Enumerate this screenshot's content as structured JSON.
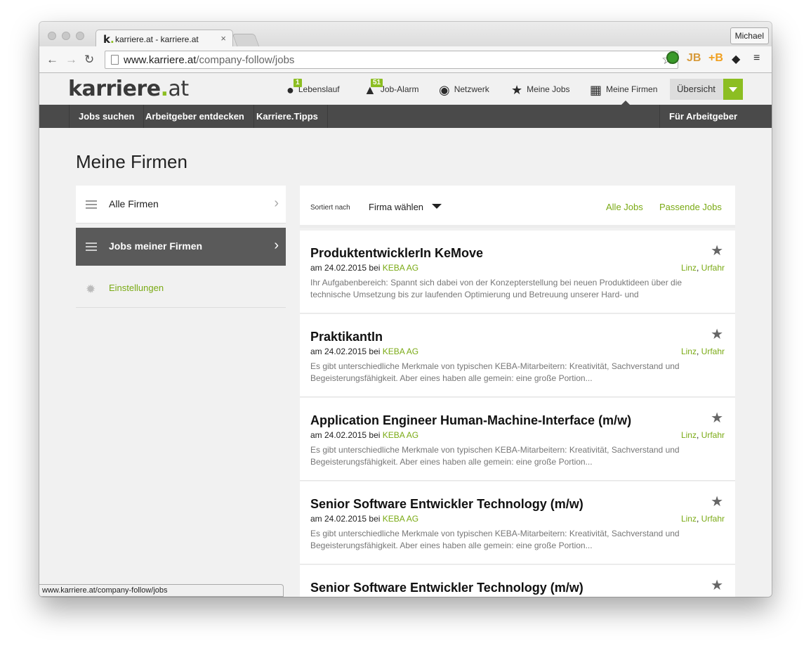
{
  "browser": {
    "tab_title": "karriere.at - karriere.at",
    "tab_close": "×",
    "profile": "Michael",
    "url_host": "www.karriere.at",
    "url_path": "/company-follow/jobs",
    "status_url": "www.karriere.at/company-follow/jobs",
    "extensions": [
      "JB",
      "+B"
    ]
  },
  "site": {
    "logo_main": "karriere",
    "logo_dot": ".",
    "logo_tld": "at",
    "header_nav": [
      {
        "label": "Lebenslauf",
        "icon": "user-icon",
        "badge": "1"
      },
      {
        "label": "Job-Alarm",
        "icon": "bell-icon",
        "badge": "51"
      },
      {
        "label": "Netzwerk",
        "icon": "globe-icon"
      },
      {
        "label": "Meine Jobs",
        "icon": "star-icon"
      },
      {
        "label": "Meine Firmen",
        "icon": "building-icon"
      }
    ],
    "overview_button": "Übersicht",
    "main_nav": [
      "Jobs suchen",
      "Arbeitgeber entdecken",
      "Karriere.Tipps"
    ],
    "employer_nav": "Für Arbeitgeber"
  },
  "page": {
    "title": "Meine Firmen",
    "sidebar": [
      {
        "label": "Alle Firmen"
      },
      {
        "label": "Jobs meiner Firmen",
        "active": true
      },
      {
        "label": "Einstellungen"
      }
    ],
    "sort_label": "Sortiert nach",
    "sort_select": "Firma wählen",
    "filter_all": "Alle Jobs",
    "filter_matching": "Passende Jobs",
    "jobs": [
      {
        "title": "ProduktentwicklerIn KeMove",
        "date_prefix": "am 24.02.2015 bei",
        "company": "KEBA AG",
        "loc1": "Linz",
        "loc2": "Urfahr",
        "desc": "Ihr Aufgabenbereich: Spannt sich dabei von der Konzepterstellung bei neuen Produktideen über die technische Umsetzung bis zur laufenden Optimierung und Betreuung unserer Hard- und"
      },
      {
        "title": "PraktikantIn",
        "date_prefix": "am 24.02.2015 bei",
        "company": "KEBA AG",
        "loc1": "Linz",
        "loc2": "Urfahr",
        "desc": "Es gibt unterschiedliche Merkmale von typischen KEBA-Mitarbeitern: Kreativität, Sachverstand und Begeisterungsfähigkeit. Aber eines haben alle gemein: eine große Portion..."
      },
      {
        "title": "Application Engineer Human-Machine-Interface (m/w)",
        "date_prefix": "am 24.02.2015 bei",
        "company": "KEBA AG",
        "loc1": "Linz",
        "loc2": "Urfahr",
        "desc": "Es gibt unterschiedliche Merkmale von typischen KEBA-Mitarbeitern: Kreativität, Sachverstand und Begeisterungsfähigkeit. Aber eines haben alle gemein: eine große Portion..."
      },
      {
        "title": "Senior Software Entwickler Technology (m/w)",
        "date_prefix": "am 24.02.2015 bei",
        "company": "KEBA AG",
        "loc1": "Linz",
        "loc2": "Urfahr",
        "desc": "Es gibt unterschiedliche Merkmale von typischen KEBA-Mitarbeitern: Kreativität, Sachverstand und Begeisterungsfähigkeit. Aber eines haben alle gemein: eine große Portion..."
      },
      {
        "title": "Senior Software Entwickler Technology (m/w)"
      }
    ]
  },
  "colors": {
    "accent": "#8cbe22",
    "dark_nav": "#4a4a4a",
    "background": "#f1f1f1"
  }
}
